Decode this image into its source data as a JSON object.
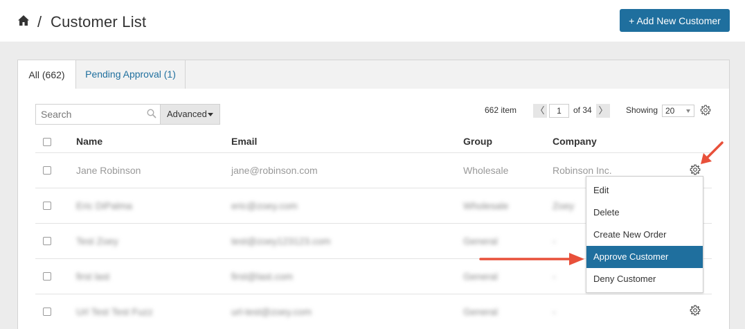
{
  "header": {
    "separator": "/",
    "title": "Customer List",
    "add_button": "+ Add New Customer"
  },
  "tabs": [
    {
      "label": "All (662)",
      "active": true
    },
    {
      "label": "Pending Approval (1)",
      "active": false
    }
  ],
  "toolbar": {
    "search_placeholder": "Search",
    "advanced_label": "Advanced",
    "item_count": "662 item",
    "page_prev": "〈",
    "page_current": "1",
    "page_of": "of 34",
    "page_next": "〉",
    "showing_label": "Showing",
    "showing_value": "20"
  },
  "table": {
    "columns": [
      "Name",
      "Email",
      "Group",
      "Company"
    ],
    "rows": [
      {
        "name": "Jane Robinson",
        "email": "jane@robinson.com",
        "group": "Wholesale",
        "company": "Robinson Inc.",
        "blurred": false
      },
      {
        "name": "Eric DiPalma",
        "email": "eric@zoey.com",
        "group": "Wholesale",
        "company": "Zoey",
        "blurred": true
      },
      {
        "name": "Test Zoey",
        "email": "test@zoey123123.com",
        "group": "General",
        "company": "-",
        "blurred": true
      },
      {
        "name": "first last",
        "email": "first@last.com",
        "group": "General",
        "company": "-",
        "blurred": true
      },
      {
        "name": "Url Test Test Fuzz",
        "email": "url-test@zoey.com",
        "group": "General",
        "company": "-",
        "blurred": true
      }
    ]
  },
  "row_menu": {
    "items": [
      "Edit",
      "Delete",
      "Create New Order",
      "Approve Customer",
      "Deny Customer"
    ],
    "highlighted": "Approve Customer"
  },
  "colors": {
    "accent": "#1f6f9e",
    "annotation_arrow": "#e8503a",
    "page_background": "#ececec"
  },
  "icons": [
    "home-icon",
    "search-icon",
    "gear-icon",
    "chevron-down-icon",
    "arrow-annotation"
  ]
}
